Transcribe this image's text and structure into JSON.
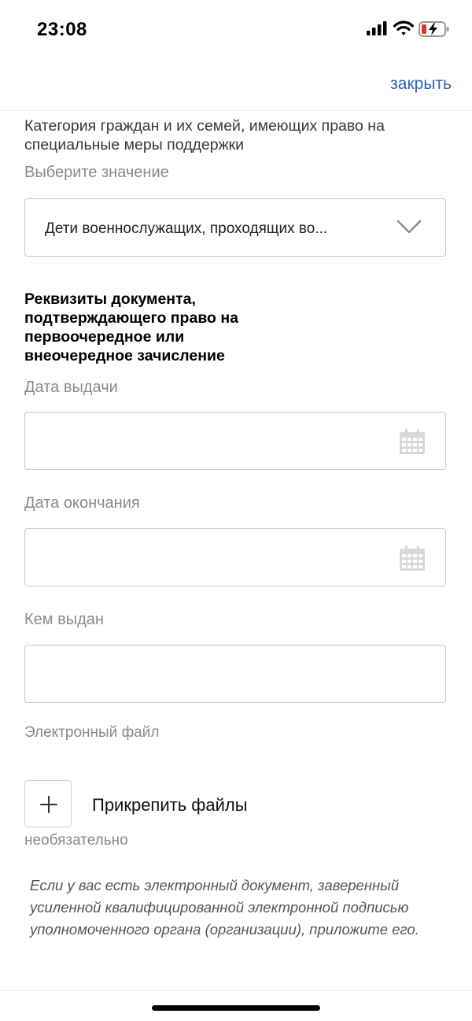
{
  "status_bar": {
    "time": "23:08"
  },
  "header": {
    "close_label": "закрыть"
  },
  "category": {
    "title": "Категория граждан и их семей, имеющих право на специальные меры поддержки",
    "hint": "Выберите значение",
    "selected_value": "Дети военнослужащих, проходящих во..."
  },
  "document": {
    "section_title": "Реквизиты документа, подтверждающего право на первоочередное или внеочередное зачисление",
    "issue_date_label": "Дата выдачи",
    "issue_date_value": "",
    "end_date_label": "Дата окончания",
    "end_date_value": "",
    "issued_by_label": "Кем выдан",
    "issued_by_value": "",
    "file_label": "Электронный файл",
    "attach_label": "Прикрепить файлы",
    "optional_label": "необязательно",
    "note": "Если у вас есть электронный документ, заверенный усиленной квалифицированной электронной подписью уполномоченного органа (организации), приложите его."
  },
  "colors": {
    "accent": "#2d63b8",
    "battery_low": "#e0322c"
  },
  "icons": [
    "signal-icon",
    "wifi-icon",
    "battery-charging-icon",
    "chevron-down-icon",
    "calendar-icon",
    "plus-icon"
  ]
}
